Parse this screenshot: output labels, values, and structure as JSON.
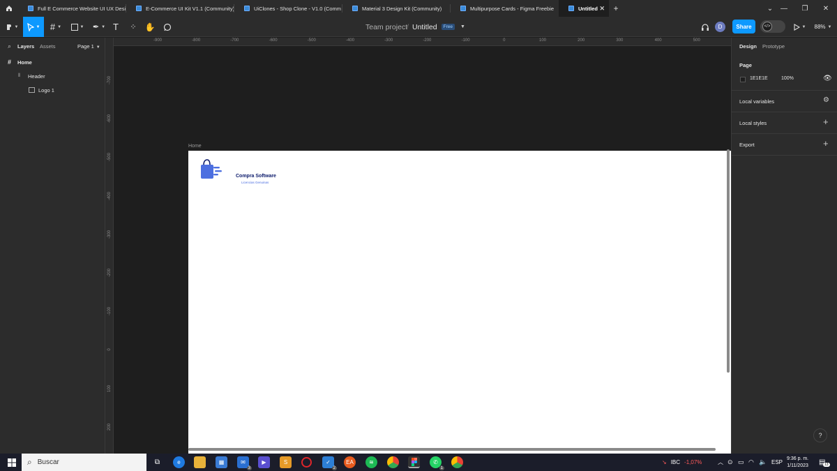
{
  "tabs": [
    {
      "label": "Full E Commerce Website UI UX Desi"
    },
    {
      "label": "E-Commerce UI Kit V1.1 (Community)"
    },
    {
      "label": "UiClones - Shop Clone - V1.0 (Comm"
    },
    {
      "label": "Material 3 Design Kit (Community)"
    },
    {
      "label": "Multipurpose Cards - Figma Freebie"
    },
    {
      "label": "Untitled",
      "active": true
    }
  ],
  "toolbar": {
    "project": "Team project",
    "separator": "/",
    "file_name": "Untitled",
    "plan_badge": "Free",
    "avatar_initial": "D",
    "share_label": "Share",
    "zoom": "88%"
  },
  "left_panel": {
    "tab_layers": "Layers",
    "tab_assets": "Assets",
    "page_selector": "Page 1",
    "layers": [
      {
        "name": "Home",
        "level": 0
      },
      {
        "name": "Header",
        "level": 1
      },
      {
        "name": "Logo 1",
        "level": 2
      }
    ]
  },
  "rulers": {
    "horizontal": [
      "-900",
      "-800",
      "-700",
      "-600",
      "-500",
      "-400",
      "-300",
      "-200",
      "-100",
      "0",
      "100",
      "200",
      "300",
      "400",
      "500",
      "600"
    ],
    "vertical": [
      "-700",
      "-600",
      "-500",
      "-400",
      "-300",
      "-200",
      "-100",
      "0",
      "100",
      "200"
    ]
  },
  "canvas": {
    "frame_label": "Home",
    "logo_title": "Compra Software",
    "logo_subtitle": "Licencias Genuinas"
  },
  "right_panel": {
    "tab_design": "Design",
    "tab_prototype": "Prototype",
    "page_section": "Page",
    "page_color_hex": "1E1E1E",
    "page_opacity": "100%",
    "local_variables": "Local variables",
    "local_styles": "Local styles",
    "export": "Export",
    "help": "?"
  },
  "taskbar": {
    "search_placeholder": "Buscar",
    "stock_symbol": "IBC",
    "stock_change": "-1,07%",
    "language": "ESP",
    "time": "9:36 p. m.",
    "date": "1/11/2023",
    "notifications": "13",
    "mail_badge": "3",
    "vscode_badge": "2",
    "whatsapp_badge": "1"
  },
  "colors": {
    "accent": "#0d99ff",
    "canvas_bg": "#1e1e1e",
    "panel_bg": "#2c2c2c",
    "stock_negative": "#ff5a5a"
  }
}
